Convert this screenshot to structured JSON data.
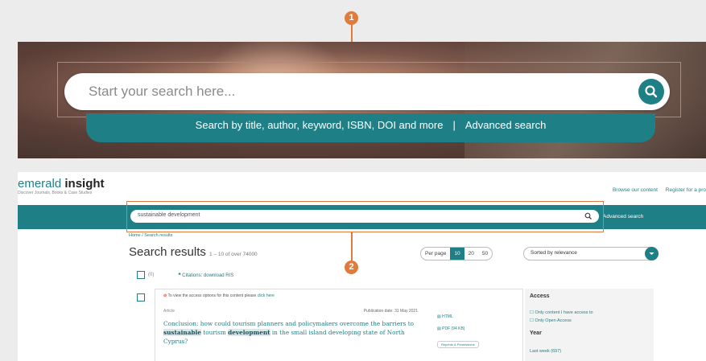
{
  "callouts": [
    "1",
    "2"
  ],
  "hero": {
    "search_placeholder": "Start your search here...",
    "strip_text": "Search by title, author, keyword, ISBN, DOI and more",
    "strip_separator": "|",
    "advanced_link": "Advanced search"
  },
  "site": {
    "logo_light": "emerald",
    "logo_bold": "insight",
    "tagline": "Discover Journals, Books & Case Studies",
    "top_links": [
      "Browse our content",
      "Register for a pro"
    ],
    "search_value": "sustainable development",
    "advanced_link": "Advanced search",
    "breadcrumb": "Home  /  Search results",
    "results_title": "Search results",
    "results_count": "1 – 10 of over 74000",
    "per_page_label": "Per page",
    "per_page_options": [
      "10",
      "20",
      "50"
    ],
    "per_page_selected": "10",
    "sort_label": "Sorted by relevance",
    "select_count": "(0)",
    "citations_label": "Citations: download RIS",
    "notice_text": "To view the access options for this content please",
    "notice_link": "click here",
    "article_type": "Article",
    "publication_date": "Publication date: 31 May 2021",
    "article_title_parts": [
      "Conclusion: how could tourism planners and policymakers overcome the barriers to ",
      "sustainable",
      " tourism ",
      "development",
      " in the small island developing state of North Cyprus?"
    ],
    "formats": [
      "HTML",
      "PDF (94 KB)"
    ],
    "reprints": "Reprints & Permissions",
    "sidebar": {
      "access_heading": "Access",
      "access_options": [
        "Only content I have access to",
        "Only Open Access"
      ],
      "year_heading": "Year",
      "year_options": [
        "Last week (697)"
      ]
    }
  },
  "colors": {
    "teal": "#1f7f86",
    "callout": "#e07b3c"
  }
}
